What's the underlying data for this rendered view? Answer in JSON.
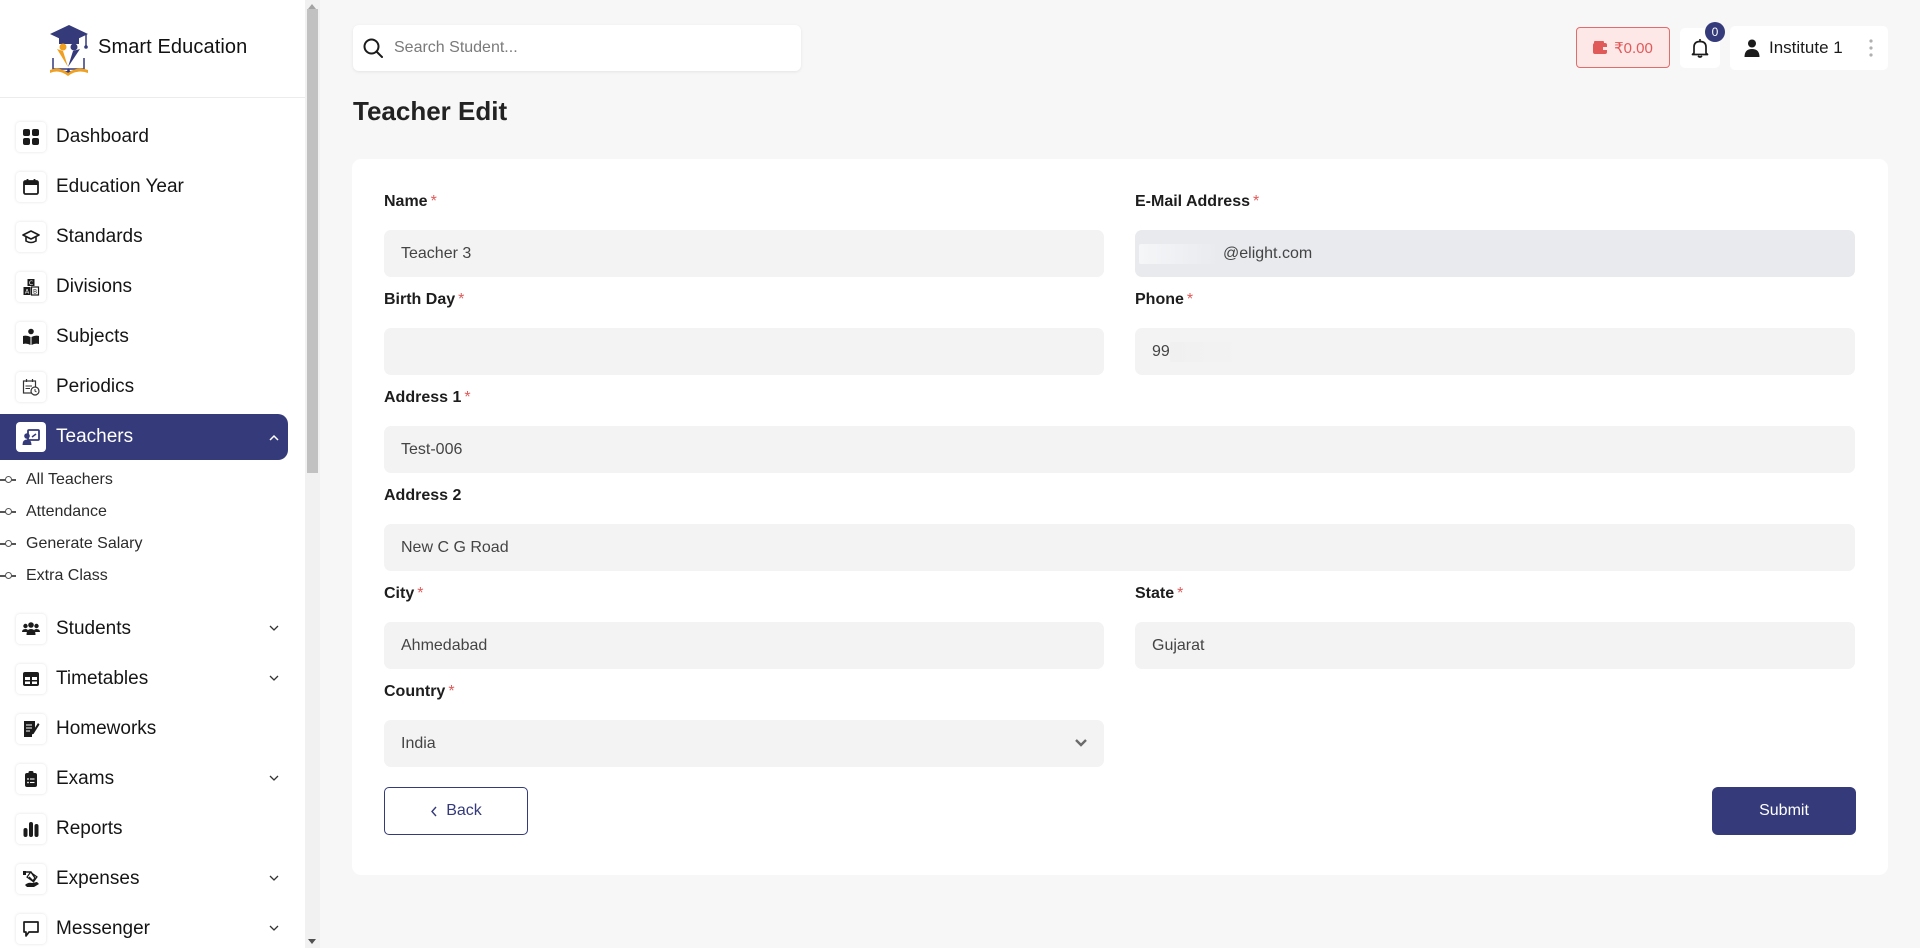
{
  "brand": {
    "name": "Smart Education",
    "logo_icon": "graduation-cap-book-icon"
  },
  "sidebar": {
    "items": [
      {
        "label": "Dashboard",
        "icon": "dashboard-grid-icon",
        "expandable": false
      },
      {
        "label": "Education Year",
        "icon": "calendar-icon",
        "expandable": false
      },
      {
        "label": "Standards",
        "icon": "graduation-cap-icon",
        "expandable": false
      },
      {
        "label": "Divisions",
        "icon": "abc-blocks-icon",
        "expandable": false
      },
      {
        "label": "Subjects",
        "icon": "reader-book-icon",
        "expandable": false
      },
      {
        "label": "Periodics",
        "icon": "calendar-clock-icon",
        "expandable": false
      },
      {
        "label": "Teachers",
        "icon": "teacher-board-icon",
        "expandable": true,
        "active": true,
        "expanded": true
      },
      {
        "label": "Students",
        "icon": "users-group-icon",
        "expandable": true
      },
      {
        "label": "Timetables",
        "icon": "table-icon",
        "expandable": true
      },
      {
        "label": "Homeworks",
        "icon": "notepad-pen-icon",
        "expandable": false
      },
      {
        "label": "Exams",
        "icon": "clipboard-list-icon",
        "expandable": true
      },
      {
        "label": "Reports",
        "icon": "bar-chart-icon",
        "expandable": false
      },
      {
        "label": "Expenses",
        "icon": "hand-money-icon",
        "expandable": true
      },
      {
        "label": "Messenger",
        "icon": "chat-bubble-icon",
        "expandable": true
      }
    ],
    "teachers_submenu": [
      "All Teachers",
      "Attendance",
      "Generate Salary",
      "Extra Class"
    ]
  },
  "topbar": {
    "search_placeholder": "Search Student...",
    "wallet_balance": "₹0.00",
    "notification_count": "0",
    "profile_name": "Institute 1"
  },
  "page": {
    "title": "Teacher Edit"
  },
  "form": {
    "name": {
      "label": "Name",
      "value": "Teacher 3",
      "required": true
    },
    "email": {
      "label": "E-Mail Address",
      "value": "@elight.com",
      "required": true,
      "readonly": true
    },
    "birthday": {
      "label": "Birth Day",
      "value": "",
      "required": true
    },
    "phone": {
      "label": "Phone",
      "value": "99",
      "required": true
    },
    "address1": {
      "label": "Address 1",
      "value": "Test-006",
      "required": true
    },
    "address2": {
      "label": "Address 2",
      "value": "New C G Road",
      "required": false
    },
    "city": {
      "label": "City",
      "value": "Ahmedabad",
      "required": true
    },
    "state": {
      "label": "State",
      "value": "Gujarat",
      "required": true
    },
    "country": {
      "label": "Country",
      "value": "India",
      "required": true
    },
    "required_mark": "*",
    "back_label": "Back",
    "submit_label": "Submit"
  },
  "colors": {
    "accent": "#343a7a",
    "danger": "#e05a5a",
    "wallet_bg": "#fde7e7",
    "input_bg": "#f3f3f3",
    "page_bg": "#f7f7f7"
  }
}
